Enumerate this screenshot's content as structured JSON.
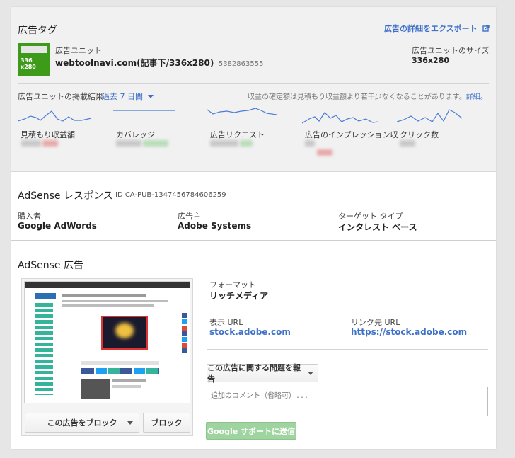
{
  "header": {
    "title": "広告タグ",
    "export_link": "広告の詳細をエクスポート"
  },
  "ad_unit": {
    "thumb_size": "336\nx280",
    "label": "広告ユニット",
    "name": "webtoolnavi.com(記事下/336x280)",
    "id": "5382863555",
    "size_label": "広告ユニットのサイズ",
    "size_value": "336x280"
  },
  "performance": {
    "label": "広告ユニットの掲載結果",
    "range": "過去 7 日間",
    "note": "収益の確定額は見積もり収益額より若干少なくなることがあります。",
    "note_link": "詳細。",
    "metrics": [
      {
        "label": "見積もり収益額"
      },
      {
        "label": "カバレッジ"
      },
      {
        "label": "広告リクエスト"
      },
      {
        "label": "広告のインプレッション収"
      },
      {
        "label": "クリック数"
      }
    ]
  },
  "response": {
    "title": "AdSense レスポンス",
    "id": "ID CA-PUB-1347456784606259",
    "buyer_label": "購入者",
    "buyer_value": "Google AdWords",
    "advertiser_label": "広告主",
    "advertiser_value": "Adobe Systems",
    "targeting_label": "ターゲット タイプ",
    "targeting_value": "インタレスト ベース"
  },
  "ad": {
    "title": "AdSense 広告",
    "format_label": "フォーマット",
    "format_value": "リッチメディア",
    "display_url_label": "表示 URL",
    "display_url_value": "stock.adobe.com",
    "dest_url_label": "リンク先 URL",
    "dest_url_value": "https://stock.adobe.com",
    "block_ad_button": "この広告をブロック",
    "block_button": "ブロック",
    "report_button": "この広告に関する問題を報告",
    "comment_placeholder": "追加のコメント（省略可）...",
    "submit_button": "Google サポートに送信"
  },
  "colors": {
    "accent": "#3d70c9",
    "thumb_green": "#3e9b1a",
    "submit_green": "#9fd39f"
  }
}
